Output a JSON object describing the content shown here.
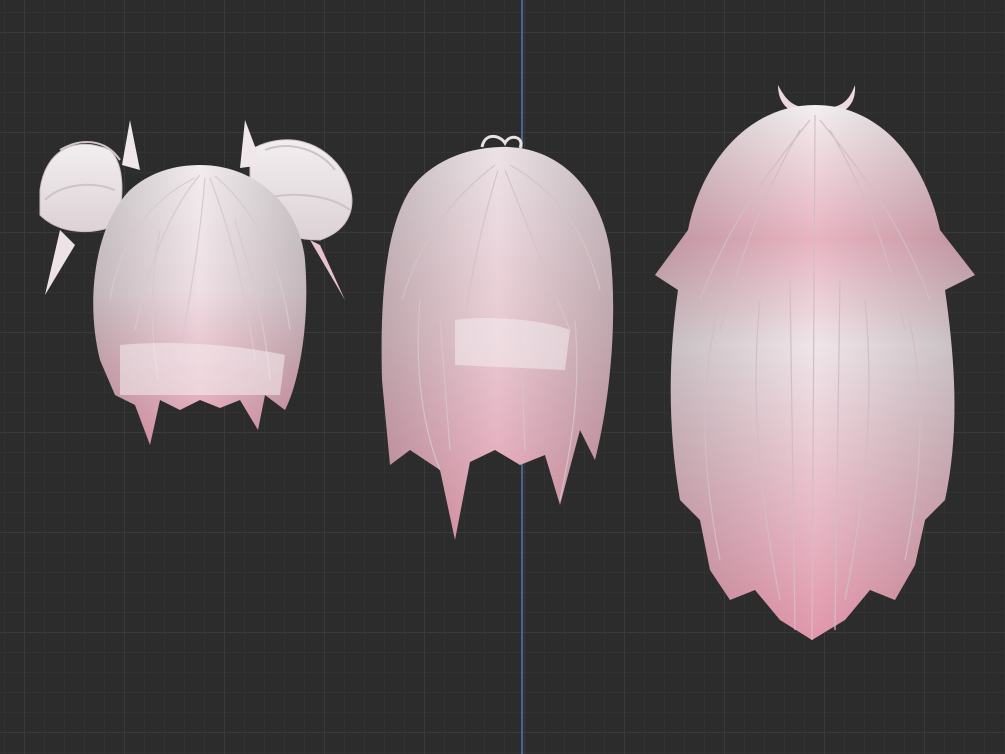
{
  "viewport": {
    "background_color": "#2c2c2c",
    "grid_line_color": "#3a3a3a",
    "z_axis_color": "#4a6d9e"
  },
  "models": [
    {
      "name": "twin-buns-bob-hair-model",
      "base_color": "#ece6e8",
      "tip_color": "#e8a6b8"
    },
    {
      "name": "bob-with-ahoge-hair-model",
      "base_color": "#ece6e8",
      "tip_color": "#e8a6b8"
    },
    {
      "name": "long-layered-hair-model",
      "base_color": "#ece6e8",
      "tip_color": "#e8a6b8"
    }
  ]
}
